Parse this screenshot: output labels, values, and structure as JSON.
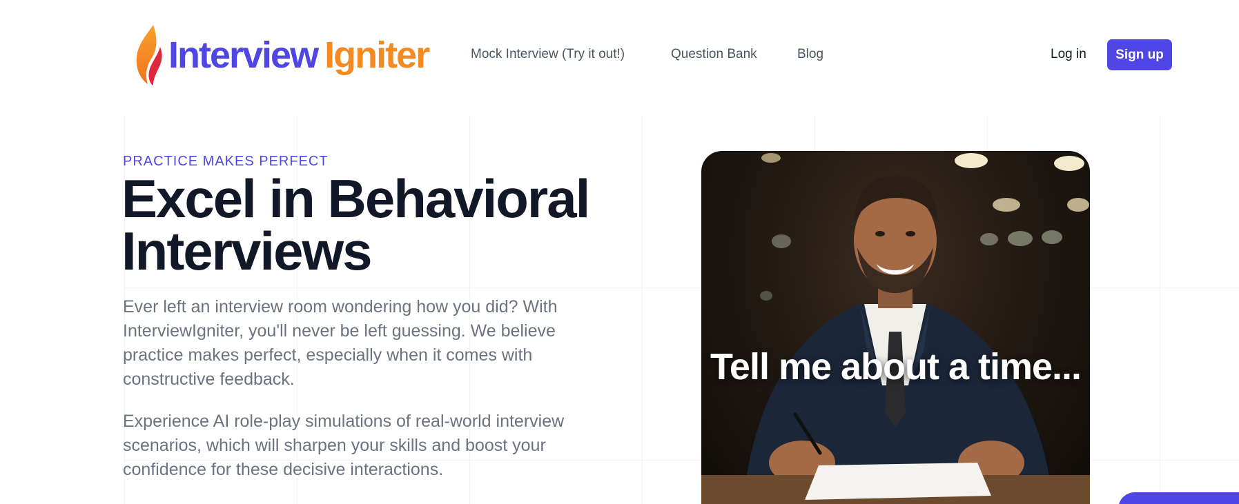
{
  "header": {
    "logo": {
      "part1": "Interview",
      "part2": "Igniter"
    },
    "nav": [
      {
        "label": "Mock Interview (Try it out!)"
      },
      {
        "label": "Question Bank"
      },
      {
        "label": "Blog"
      }
    ],
    "login_label": "Log in",
    "signup_label": "Sign up"
  },
  "hero": {
    "eyebrow": "PRACTICE MAKES PERFECT",
    "headline_line1": "Excel in Behavioral",
    "headline_line2": "Interviews",
    "paragraph1": "Ever left an interview room wondering how you did? With InterviewIgniter, you'll never be left guessing. We believe practice makes perfect, especially when it comes with constructive feedback.",
    "paragraph2": "Experience AI role-play simulations of real-world interview scenarios, which will sharpen your skills and boost your confidence for these decisive interactions.",
    "image_caption": "Tell me about a time..."
  },
  "colors": {
    "brand": "#4f46e5",
    "accent": "#f48a22",
    "text": "#111827",
    "muted": "#6b7280"
  },
  "icons": {
    "logo": "flame-icon"
  }
}
